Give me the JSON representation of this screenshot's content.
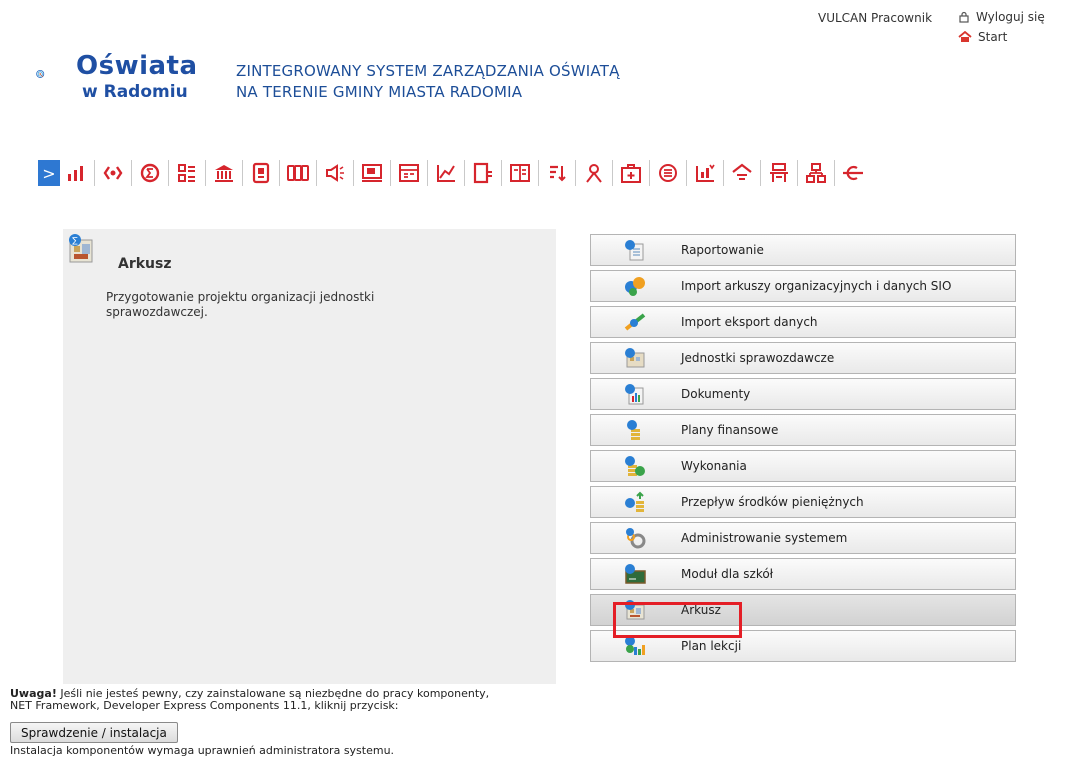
{
  "header": {
    "user_name": "VULCAN Pracownik",
    "logout_label": "Wyloguj się",
    "start_label": "Start",
    "logo_title": "Oświata",
    "logo_subtitle": "w Radomiu",
    "system_title_line1": "ZINTEGROWANY SYSTEM ZARZĄDZANIA OŚWIATĄ",
    "system_title_line2": "NA TERENIE GMINY MIASTA RADOMIA"
  },
  "colors": {
    "brand_blue": "#1f4fa3",
    "toolbar_red": "#d6252d",
    "highlight_red": "#e41e26",
    "arrow_blue": "#2e78d2"
  },
  "toolbar": {
    "icons": [
      "reports-icon",
      "exchange-icon",
      "sigma-icon",
      "list-icon",
      "bank-icon",
      "document-icon",
      "grades-icon",
      "megaphone-icon",
      "screen-icon",
      "form-icon",
      "chart-icon",
      "book-icon",
      "open-book-icon",
      "sort-icon",
      "person-icon",
      "medical-icon",
      "menu-circle-icon",
      "calendar-icon",
      "school-icon",
      "desk-icon",
      "hierarchy-icon",
      "exit-icon"
    ]
  },
  "panel": {
    "title": "Arkusz",
    "description": "Przygotowanie projektu organizacji jednostki sprawozdawczej."
  },
  "menu": {
    "items": [
      {
        "label": "Raportowanie",
        "icon": "report-icon"
      },
      {
        "label": "Import arkuszy organizacyjnych i danych SIO",
        "icon": "import-sio-icon"
      },
      {
        "label": "Import eksport danych",
        "icon": "import-export-icon"
      },
      {
        "label": "Jednostki sprawozdawcze",
        "icon": "units-icon"
      },
      {
        "label": "Dokumenty",
        "icon": "documents-icon"
      },
      {
        "label": "Plany finansowe",
        "icon": "financial-plans-icon"
      },
      {
        "label": "Wykonania",
        "icon": "execution-icon"
      },
      {
        "label": "Przepływ środków pieniężnych",
        "icon": "cash-flow-icon"
      },
      {
        "label": "Administrowanie systemem",
        "icon": "admin-icon"
      },
      {
        "label": "Moduł dla szkół",
        "icon": "school-module-icon"
      },
      {
        "label": "Arkusz",
        "icon": "sheet-icon"
      },
      {
        "label": "Plan lekcji",
        "icon": "lesson-plan-icon"
      }
    ]
  },
  "footer": {
    "warning_bold": "Uwaga!",
    "warning_text1": " Jeśli nie jesteś pewny, czy zainstalowane są niezbędne do pracy komponenty,",
    "warning_text2": "NET Framework, Developer Express Components 11.1, kliknij przycisk:",
    "check_button": "Sprawdzenie / instalacja",
    "admin_note": "Instalacja komponentów wymaga uprawnień administratora systemu."
  }
}
